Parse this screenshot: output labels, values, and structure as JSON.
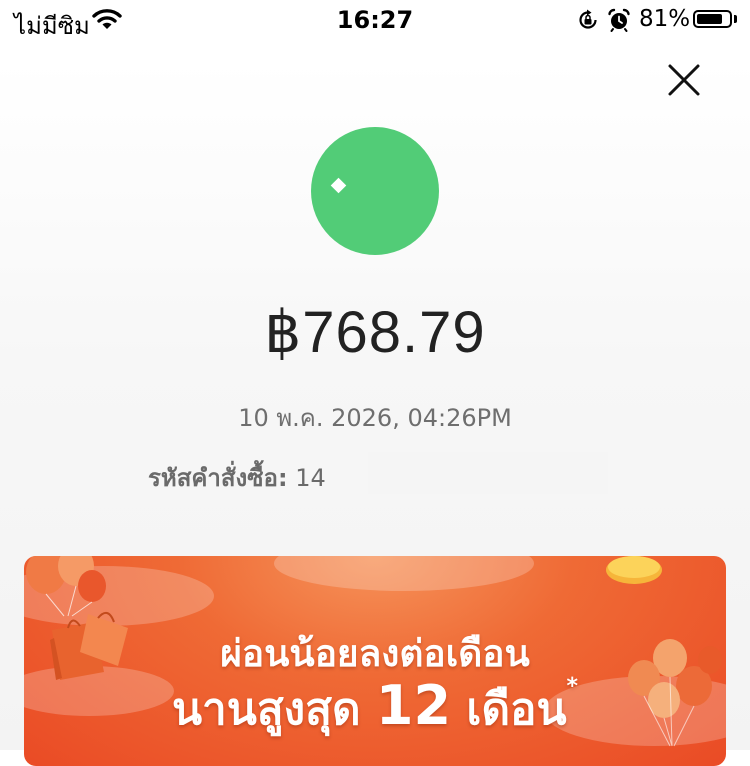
{
  "status_bar": {
    "carrier": "ไม่มีซิม",
    "time": "16:27",
    "battery_percent": "81%",
    "battery_level": 0.81
  },
  "receipt": {
    "amount": "฿768.79",
    "datetime": "10 พ.ค. 2026, 04:26PM",
    "order_label": "รหัสคำสั่งซื้อ:",
    "order_number_visible": "14",
    "status_color": "#52cc77"
  },
  "promo": {
    "line1": "ผ่อนน้อยลงต่อเดือน",
    "line2_prefix": "นานสูงสุด",
    "line2_number": "12",
    "line2_suffix": "เดือน",
    "asterisk": "*",
    "accent": "#ee5a2c"
  },
  "icons": {
    "close": "close-icon",
    "wifi": "wifi-icon",
    "rotation_lock": "rotation-lock-icon",
    "alarm": "alarm-icon",
    "battery": "battery-icon"
  }
}
